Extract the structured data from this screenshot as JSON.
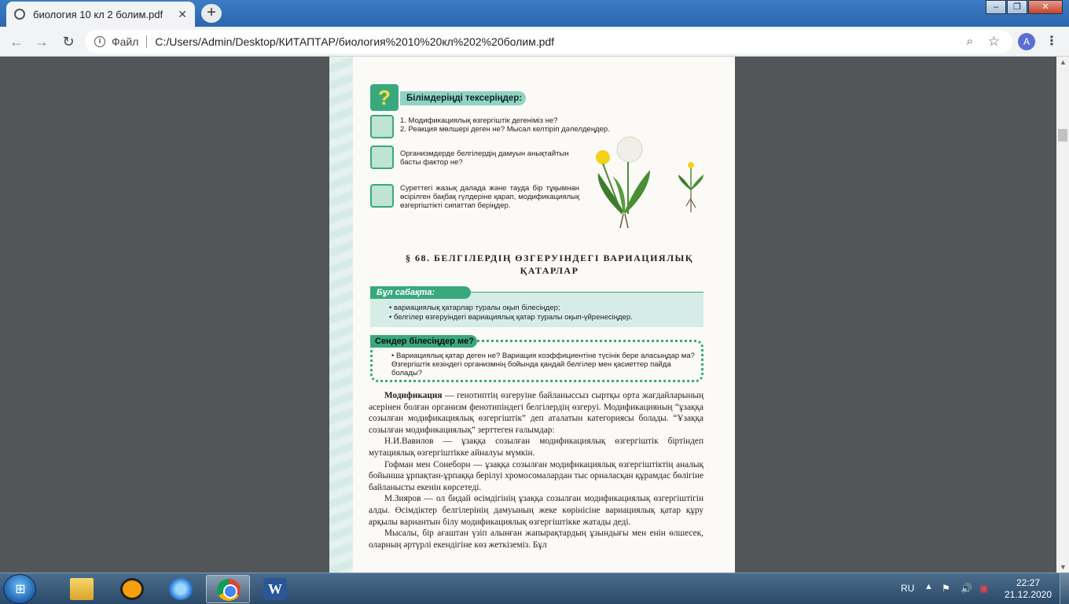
{
  "browser": {
    "tab_title": "биология 10 кл 2 болим.pdf",
    "tab_close": "✕",
    "new_tab": "+",
    "window_buttons": {
      "minimize": "–",
      "maximize": "❐",
      "close": "✕"
    },
    "nav": {
      "back": "←",
      "forward": "→",
      "reload": "↻"
    },
    "address_scheme": "Файл",
    "address_url": "C:/Users/Admin/Desktop/КИТАПТАР/биология%2010%20кл%202%20болим.pdf",
    "avatar_letter": "A",
    "menu": "⋮"
  },
  "pdf": {
    "check_title": "Білімдеріңді тексеріңдер:",
    "check_icon": "?",
    "q1": "1. Модификациялық өзгергіштік дегеніміз не?",
    "q2": "2. Реакция мөлшері деген не? Мысал келтіріп дәлелдеңдер.",
    "q3": "Организмдерде белгілердің дамуын анықтайтын басты фактор не?",
    "q4": "Суреттегі жазық далада және тауда бір тұқымнан өсірілген бақбақ гүлдеріне қарап, модификациялық өзгергіштікті сипаттап беріңдер.",
    "section_title_line1": "§ 68.  БЕЛГІЛЕРДІҢ   ӨЗГЕРУІНДЕГІ   ВАРИАЦИЯЛЫҚ",
    "section_title_line2": "ҚАТАРЛАР",
    "lesson_title": "Бұл сабақта:",
    "lesson_item1": "• вариациялық қатарлар туралы оқып білесіңдер;",
    "lesson_item2": "• белгілер өзгеруіндегі вариациялық қатар туралы оқып-үйренесіңдер.",
    "know_title": "Сендер білесіңдер ме?",
    "know_text": "• Вариациялық қатар деген не? Вариация коэффициентіне түсінік бере аласыңдар ма? Өзгергіштік кезіндегі организмнің бойында қандай белгілер мен қасиеттер пайда болады?",
    "p1_bold": "Модификация",
    "p1_rest": " — генотиптің өзгеруіне байланыссыз сыртқы орта жағдайларының әсерінен болған организм фенотипіндегі белгілердің өзгеруі. Модификацияның “ұзаққа созылған модификациялық өзгергіштік” деп аталатын категориясы болады. “Ұзаққа созылған модификациялық” зерттеген ғалымдар:",
    "p2": "Н.И.Вавилов — ұзаққа созылған модификациялық өзгергіштік біртіндеп мутациялық өзгергіштікке айналуы мүмкін.",
    "p3": "Гофман мен Сонеборн — ұзаққа созылған модификациялық өзгергіштіктің аналық бойынша ұрпақтан-ұрпаққа берілуі хромосомалардан тыс орналасқан құрамдас бөлігіне байланысты екенін көрсетеді.",
    "p4": "М.Зияров — ол бидай өсімдігінің ұзаққа созылған модификациялық өзгергіштігін алды. Өсімдіктер белгілерінің дамуының жеке көрінісіне вариациялық қатар құру арқылы вариантын білу модификациялық өзгергіштікке жатады деді.",
    "p5": "Мысалы, бір ағаштан үзіп алынған жапырақтардың ұзындығы мен енін өлшесек, оларның әртүрлі екендігіне көз жеткіземіз. Бұл"
  },
  "taskbar": {
    "word_letter": "W",
    "lang": "RU",
    "tray_arrow": "▲",
    "time": "22:27",
    "date": "21.12.2020"
  },
  "colors": {
    "accent_green": "#3aa87f",
    "light_green": "#d6ece6",
    "viewer_bg": "#525659"
  }
}
